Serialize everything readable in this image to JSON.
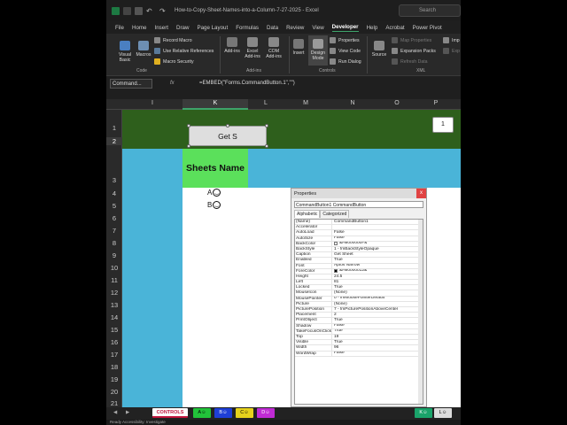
{
  "titlebar": {
    "title": "How-to-Copy-Sheet-Names-into-a-Column-7-27-2025  -  Excel",
    "search_placeholder": "Search"
  },
  "tabs": [
    "File",
    "Home",
    "Insert",
    "Draw",
    "Page Layout",
    "Formulas",
    "Data",
    "Review",
    "View",
    "Developer",
    "Help",
    "Acrobat",
    "Power Pivot"
  ],
  "ribbon": {
    "code": {
      "visual_basic": "Visual Basic",
      "macros": "Macros",
      "record_macro": "Record Macro",
      "use_relative": "Use Relative References",
      "macro_security": "Macro Security",
      "label": "Code"
    },
    "addins": {
      "addins": "Add-ins",
      "excel_addins": "Excel Add-ins",
      "com_addins": "COM Add-ins",
      "label": "Add-ins"
    },
    "controls": {
      "insert": "Insert",
      "design_mode": "Design Mode",
      "properties": "Properties",
      "view_code": "View Code",
      "run_dialog": "Run Dialog",
      "label": "Controls"
    },
    "xml": {
      "source": "Source",
      "map_properties": "Map Properties",
      "expansion_packs": "Expansion Packs",
      "refresh_data": "Refresh Data",
      "import": "Imp",
      "export": "Exp",
      "label": "XML"
    }
  },
  "formula_bar": {
    "name_box": "Command...",
    "fx": "fx",
    "formula": "=EMBED(\"Forms.CommandButton.1\",\"\")"
  },
  "columns": [
    "I",
    "K",
    "L",
    "M",
    "N",
    "O",
    "P"
  ],
  "rows": [
    "1",
    "2",
    "3",
    "4",
    "5",
    "6",
    "7",
    "8",
    "9",
    "10",
    "11",
    "12",
    "13",
    "14",
    "15",
    "16",
    "17",
    "18",
    "19",
    "20",
    "21"
  ],
  "sheet": {
    "button_label": "Get S",
    "header_cell": "Sheets Name",
    "page_number": "1",
    "items": [
      {
        "letter": "A",
        "icon": "smiley-icon"
      },
      {
        "letter": "B",
        "icon": "smiley-icon"
      }
    ]
  },
  "properties": {
    "title": "Properties",
    "close": "x",
    "object_select": "CommandButton1  CommandButton",
    "tab_alpha": "Alphabetic",
    "tab_cat": "Categorized",
    "rows": [
      {
        "k": "(Name)",
        "v": "CommandButton1"
      },
      {
        "k": "Accelerator",
        "v": ""
      },
      {
        "k": "AutoLoad",
        "v": "False"
      },
      {
        "k": "AutoSize",
        "v": "False"
      },
      {
        "k": "BackColor",
        "v": "&H8000000F&",
        "swatch": "#f0f0f0"
      },
      {
        "k": "BackStyle",
        "v": "1 - fmBackStyleOpaque"
      },
      {
        "k": "Caption",
        "v": "Get Sheet"
      },
      {
        "k": "Enabled",
        "v": "True"
      },
      {
        "k": "Font",
        "v": "Aptos Narrow"
      },
      {
        "k": "ForeColor",
        "v": "&H80000012&",
        "swatch": "#000000"
      },
      {
        "k": "Height",
        "v": "24.5"
      },
      {
        "k": "Left",
        "v": "81"
      },
      {
        "k": "Locked",
        "v": "True"
      },
      {
        "k": "MouseIcon",
        "v": "(None)"
      },
      {
        "k": "MousePointer",
        "v": "0 - fmMousePointerDefault"
      },
      {
        "k": "Picture",
        "v": "(None)"
      },
      {
        "k": "PicturePosition",
        "v": "7 - fmPicturePositionAboveCenter"
      },
      {
        "k": "Placement",
        "v": "2"
      },
      {
        "k": "PrintObject",
        "v": "True"
      },
      {
        "k": "Shadow",
        "v": "False"
      },
      {
        "k": "TakeFocusOnClick",
        "v": "True"
      },
      {
        "k": "Top",
        "v": "19"
      },
      {
        "k": "Visible",
        "v": "True"
      },
      {
        "k": "Width",
        "v": "96"
      },
      {
        "k": "WordWrap",
        "v": "False"
      }
    ]
  },
  "sheet_tabs": [
    {
      "label": "CONTROLS",
      "color": "#ffffff",
      "text": "#c0143c",
      "active": true
    },
    {
      "label": "A☺",
      "color": "#22c33a",
      "text": "#000000"
    },
    {
      "label": "B☺",
      "color": "#1e3fd6",
      "text": "#ffffff"
    },
    {
      "label": "C☺",
      "color": "#e6d21c",
      "text": "#000000"
    },
    {
      "label": "D☺",
      "color": "#c02bd4",
      "text": "#ffffff"
    },
    {
      "label": "K☺",
      "color": "#1aa36a",
      "text": "#ffffff"
    },
    {
      "label": "L☺",
      "color": "#dddddd",
      "text": "#000000"
    }
  ],
  "status": {
    "text": "Ready    Accessibility: Investigate"
  },
  "colors": {
    "header_green": "#2e5f1c",
    "band_blue": "#4ab4d8",
    "name_green": "#5be05b",
    "accent": "#3ea36a"
  }
}
